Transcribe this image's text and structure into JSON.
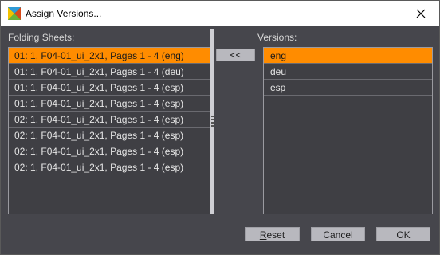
{
  "window": {
    "title": "Assign Versions...",
    "close_icon": "close-icon"
  },
  "left_panel": {
    "label": "Folding Sheets:",
    "items": [
      {
        "text": "01: 1, F04-01_ui_2x1, Pages 1 - 4 (eng)",
        "selected": true
      },
      {
        "text": "01: 1, F04-01_ui_2x1, Pages 1 - 4 (deu)",
        "selected": false
      },
      {
        "text": "01: 1, F04-01_ui_2x1, Pages 1 - 4 (esp)",
        "selected": false
      },
      {
        "text": "01: 1, F04-01_ui_2x1, Pages 1 - 4 (esp)",
        "selected": false
      },
      {
        "text": "02: 1, F04-01_ui_2x1, Pages 1 - 4 (esp)",
        "selected": false
      },
      {
        "text": "02: 1, F04-01_ui_2x1, Pages 1 - 4 (esp)",
        "selected": false
      },
      {
        "text": "02: 1, F04-01_ui_2x1, Pages 1 - 4 (esp)",
        "selected": false
      },
      {
        "text": "02: 1, F04-01_ui_2x1, Pages 1 - 4 (esp)",
        "selected": false
      }
    ]
  },
  "move_button": {
    "label": "<<"
  },
  "right_panel": {
    "label": "Versions:",
    "items": [
      {
        "text": "eng",
        "selected": true
      },
      {
        "text": "deu",
        "selected": false
      },
      {
        "text": "esp",
        "selected": false
      }
    ]
  },
  "buttons": {
    "reset_first": "R",
    "reset_rest": "eset",
    "cancel": "Cancel",
    "ok": "OK"
  },
  "colors": {
    "selection": "#ff8c00",
    "background": "#46464c"
  }
}
